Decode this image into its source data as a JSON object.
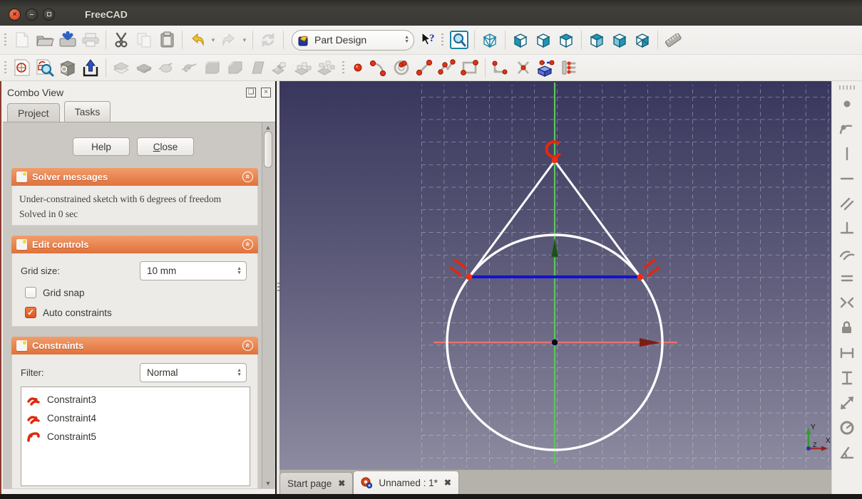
{
  "window": {
    "title": "FreeCAD"
  },
  "ui_glyphs": {
    "win_close": "×",
    "win_min": "–",
    "spin_up": "▲",
    "spin_down": "▼",
    "check": "✓",
    "collapse_chevrons": "«",
    "scroll_up": "▲",
    "scroll_down": "▼",
    "float_panel": "❏",
    "close_panel": "×",
    "dropdown_caret": "▼",
    "tab_close": "✖"
  },
  "toolbars": {
    "standard_icons": [
      "new-file",
      "open-file",
      "save-file",
      "print",
      "cut",
      "copy",
      "paste",
      "undo",
      "undo-dropdown",
      "redo",
      "redo-dropdown",
      "refresh",
      "workbench-selector",
      "whats-this",
      "fit-all",
      "axonometric-view",
      "front-view",
      "top-view",
      "right-view",
      "rear-view",
      "left-view",
      "bottom-view",
      "measure-distance"
    ],
    "workbench_value": "Part Design",
    "sketch_icons": [
      "new-sketch",
      "edit-sketch",
      "map-sketch",
      "leave-sketch",
      "pad",
      "pocket",
      "revolution",
      "groove",
      "fillet",
      "chamfer",
      "draft",
      "mirrored",
      "linear-pattern",
      "polar-pattern",
      "point",
      "arc",
      "circle",
      "line",
      "polyline",
      "rectangle",
      "fillet-sketch",
      "trim",
      "external-geometry",
      "construction-mode"
    ],
    "right_constraint_icons": [
      "coincident",
      "point-on-object",
      "vertical",
      "horizontal",
      "parallel",
      "perpendicular",
      "tangent",
      "equal",
      "symmetric",
      "lock",
      "horizontal-distance",
      "vertical-distance",
      "distance",
      "radius",
      "angle"
    ]
  },
  "combo_view": {
    "title": "Combo View",
    "tabs": [
      {
        "label": "Project",
        "active": false
      },
      {
        "label": "Tasks",
        "active": true
      }
    ],
    "help_label": "Help",
    "close_label": "Close",
    "solver": {
      "title": "Solver messages",
      "messages": [
        "Under-constrained sketch with 6 degrees of freedom",
        "Solved in 0 sec"
      ]
    },
    "edit_controls": {
      "title": "Edit controls",
      "grid_size_label": "Grid size:",
      "grid_size_value": "10 mm",
      "grid_snap_label": "Grid snap",
      "grid_snap_checked": false,
      "auto_constraints_label": "Auto constraints",
      "auto_constraints_checked": true
    },
    "constraints": {
      "title": "Constraints",
      "filter_label": "Filter:",
      "filter_value": "Normal",
      "items": [
        {
          "label": "Constraint3",
          "icon": "tangent-constraint-icon"
        },
        {
          "label": "Constraint4",
          "icon": "tangent-constraint-icon"
        },
        {
          "label": "Constraint5",
          "icon": "arc-point-constraint-icon"
        }
      ]
    }
  },
  "viewport": {
    "axis_indicator": {
      "x": "X",
      "y": "Y",
      "z": "Z"
    },
    "grid_spacing": "10 mm"
  },
  "document_tabs": [
    {
      "label": "Start page",
      "active": false
    },
    {
      "label": "Unnamed : 1*",
      "active": true
    }
  ],
  "colors": {
    "titlebar": "#3a3935",
    "toolbar": "#f1f0ee",
    "accent_orange": "#e8743f",
    "viewport_top": "#38365c",
    "viewport_bottom": "#8d8ba0",
    "sketch_line": "#ffffff",
    "selected_edge_blue": "#1212d0",
    "axis_green": "#58c858",
    "axis_red": "#e87070",
    "constraint_red": "#e02810",
    "view_cube_teal": "#2196b4"
  }
}
